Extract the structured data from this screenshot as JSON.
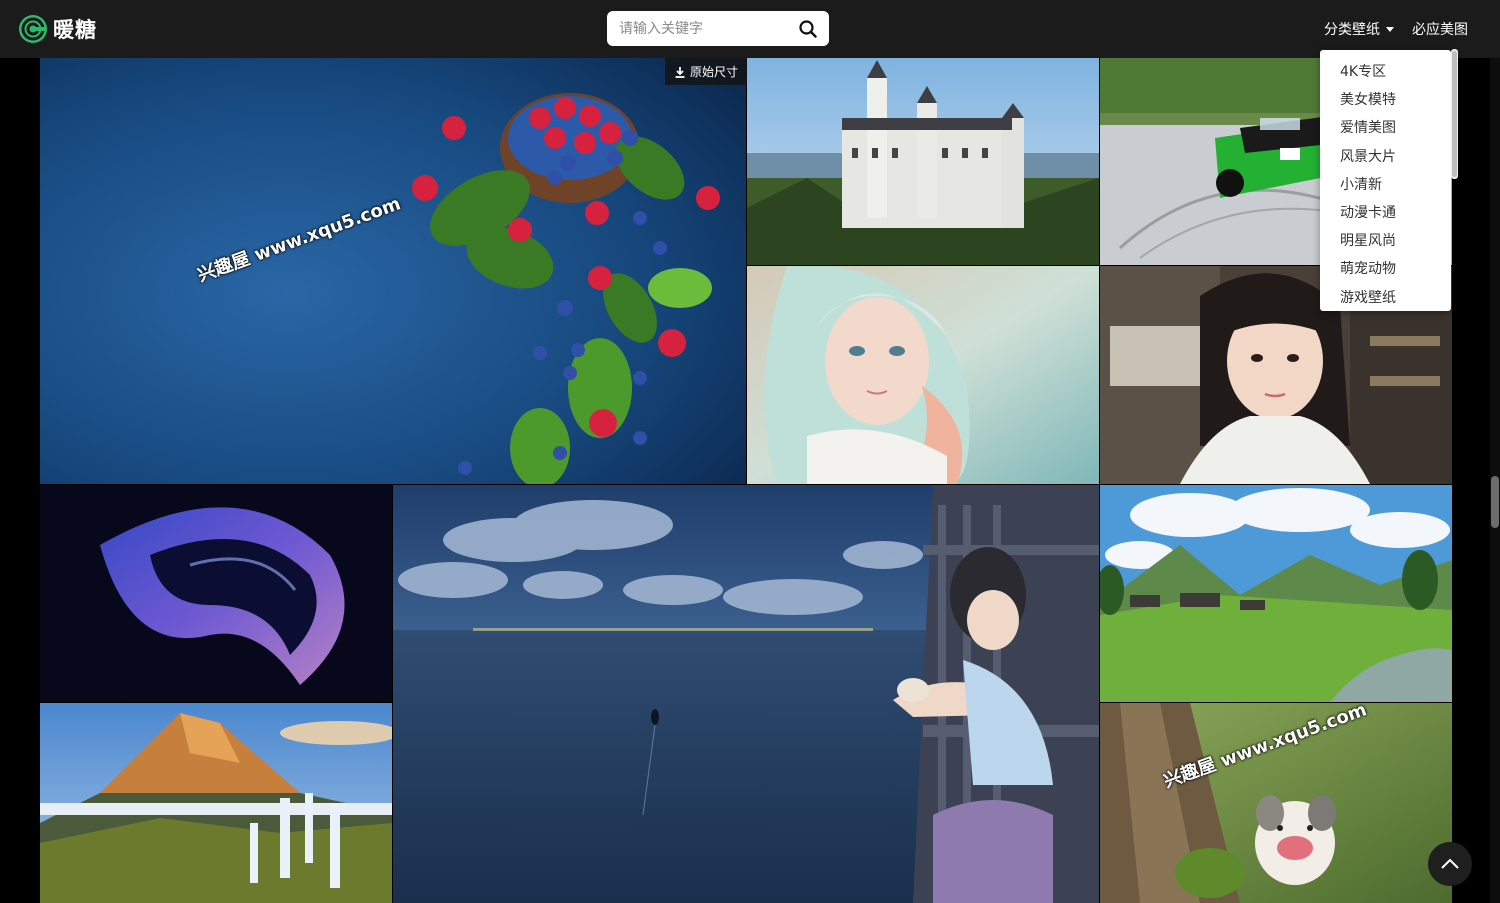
{
  "header": {
    "logo_text": "暖糖",
    "search_placeholder": "请输入关键字",
    "nav": {
      "categories_label": "分类壁纸",
      "bing_label": "必应美图"
    }
  },
  "category_menu": [
    "4K专区",
    "美女模特",
    "爱情美图",
    "风景大片",
    "小清新",
    "动漫卡通",
    "明星风尚",
    "萌宠动物",
    "游戏壁纸"
  ],
  "gallery": {
    "download_label": "原始尺寸",
    "watermark_text": "兴趣屋 www.xqu5.com"
  },
  "colors": {
    "header_bg": "#1b1b1b",
    "page_bg": "#000000"
  }
}
